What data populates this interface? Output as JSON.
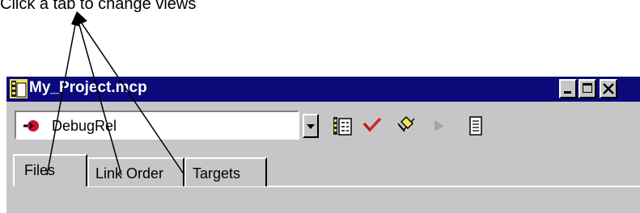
{
  "caption": "Click a tab to change views",
  "window": {
    "title": "My_Project.mcp"
  },
  "toolbar": {
    "target_value": "DebugRel",
    "icons": [
      "settings-icon",
      "check-icon",
      "make-icon",
      "run-icon",
      "debug-icon"
    ]
  },
  "tabs": [
    {
      "label": "Files",
      "active": true
    },
    {
      "label": "Link Order",
      "active": false
    },
    {
      "label": "Targets",
      "active": false
    }
  ],
  "colors": {
    "titlebar": "#0a0a7a",
    "chrome": "#c6c6c6",
    "check": "#d4262e"
  }
}
